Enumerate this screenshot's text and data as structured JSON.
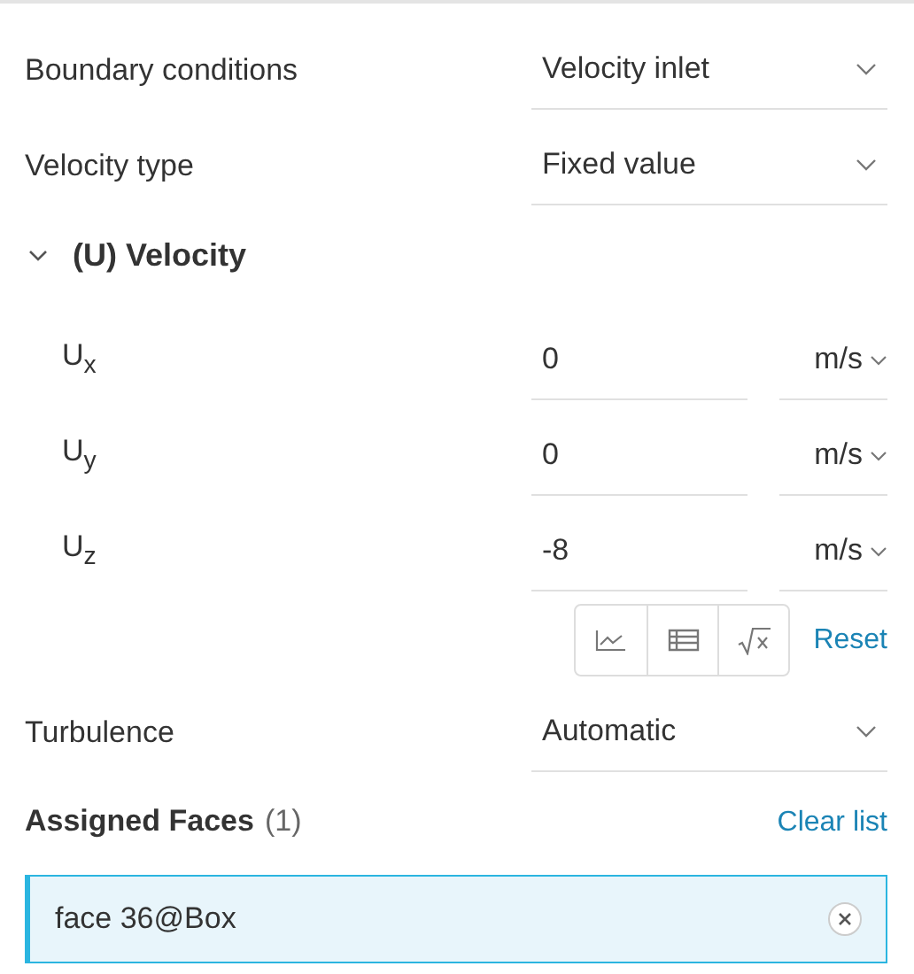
{
  "settings": [
    {
      "label": "Boundary conditions",
      "value": "Velocity inlet"
    },
    {
      "label": "Velocity type",
      "value": "Fixed value"
    }
  ],
  "velocity": {
    "title": "(U) Velocity",
    "expanded": true,
    "components": [
      {
        "label": "U$_{x}$",
        "value": "0",
        "unit": "m/s"
      },
      {
        "label": "U$_{y}$",
        "value": "0",
        "unit": "m/s"
      },
      {
        "label": "U$_{z}$",
        "value": "-8",
        "unit": "m/s"
      }
    ],
    "reset": "Reset"
  },
  "turbulence": {
    "label": "Turbulence",
    "value": "Automatic"
  },
  "assigned": {
    "title": "Assigned Faces",
    "count": "(1)",
    "clear": "Clear list",
    "items": [
      {
        "name": "face 36@Box",
        "selected": true
      }
    ]
  }
}
